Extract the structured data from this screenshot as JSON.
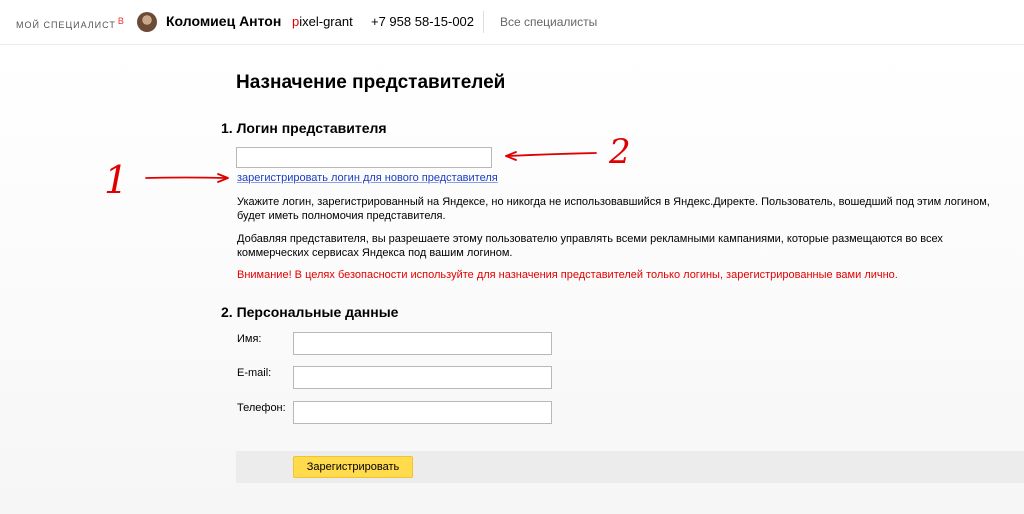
{
  "header": {
    "brand": "мой специалист",
    "brand_beta": "β",
    "user_name": "Коломиец Антон",
    "client_login_first": "p",
    "client_login_rest": "ixel-grant",
    "phone": "+7 958 58-15-002",
    "all_specialists_link": "Все специалисты"
  },
  "main": {
    "title": "Назначение представителей",
    "section1": {
      "title": "1. Логин представителя",
      "login_value": "",
      "register_link": "зарегистрировать логин для нового представителя",
      "help1": "Укажите логин, зарегистрированный на Яндексе, но никогда не использовавшийся в Яндекс.Директе. Пользователь, вошедший под этим логином, будет иметь полномочия представителя.",
      "help2": "Добавляя представителя, вы разрешаете этому пользователю управлять всеми рекламными кампаниями, которые размещаются во всех коммерческих сервисах Яндекса под вашим логином.",
      "warning": "Внимание! В целях безопасности используйте для назначения представителей только логины, зарегистрированные вами лично."
    },
    "section2": {
      "title": "2. Персональные данные",
      "fields": [
        {
          "label": "Имя:",
          "value": ""
        },
        {
          "label": "E-mail:",
          "value": ""
        },
        {
          "label": "Телефон:",
          "value": ""
        }
      ]
    },
    "submit_label": "Зарегистрировать"
  },
  "annotations": {
    "marker1": "1",
    "marker2": "2"
  },
  "colors": {
    "accent_button": "#ffdb4d",
    "link": "#1a3dc1",
    "warning": "#e30000",
    "annotation": "#e00000"
  }
}
